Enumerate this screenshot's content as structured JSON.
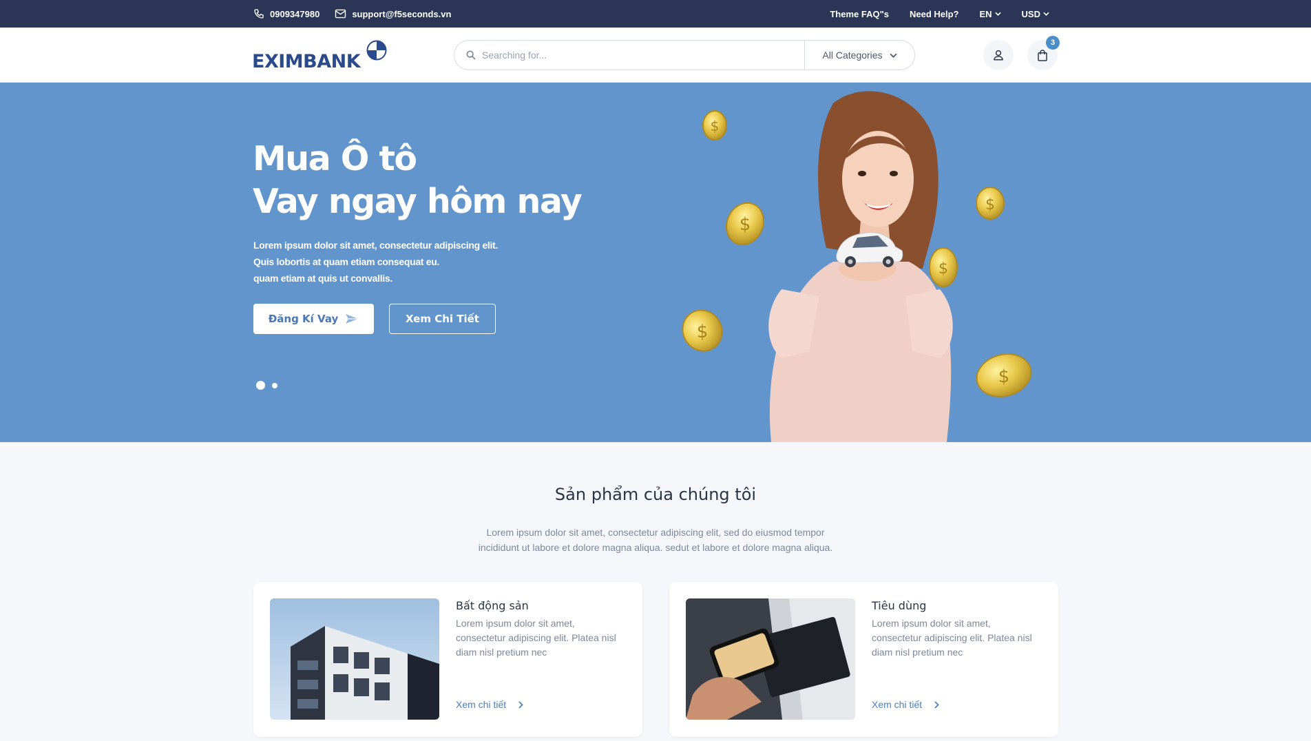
{
  "topbar": {
    "phone": "0909347980",
    "email": "support@f5seconds.vn",
    "faq": "Theme FAQ\"s",
    "help": "Need Help?",
    "language": "EN",
    "currency": "USD"
  },
  "header": {
    "logo_text": "EXIMBANK",
    "search_placeholder": "Searching for...",
    "category": "All Categories",
    "cart_count": "3"
  },
  "hero": {
    "title_line1": "Mua Ô tô",
    "title_line2": "Vay ngay hôm nay",
    "sub_line1": "Lorem ipsum dolor sit amet, consectetur adipiscing elit.",
    "sub_line2": "Quis lobortis at quam etiam consequat eu.",
    "sub_line3": "quam etiam at quis ut convallis.",
    "primary_button": "Đăng Kí Vay",
    "secondary_button": "Xem Chi Tiết",
    "slides": 2,
    "active_slide": 1
  },
  "products": {
    "title": "Sản phẩm của chúng tôi",
    "desc_line1": "Lorem ipsum dolor sit amet, consectetur adipiscing elit, sed do eiusmod tempor",
    "desc_line2": "incididunt ut labore et dolore magna aliqua. sedut et labore et dolore magna aliqua.",
    "items": [
      {
        "title": "Bất động sản",
        "text": "Lorem ipsum dolor sit amet, consectetur adipiscing elit. Platea nisl diam nisl pretium nec",
        "link": "Xem chi tiết"
      },
      {
        "title": "Tiêu dùng",
        "text": "Lorem ipsum dolor sit amet, consectetur adipiscing elit. Platea nisl diam nisl pretium nec",
        "link": "Xem chi tiết"
      }
    ]
  },
  "colors": {
    "topbar_bg": "#2b3657",
    "hero_bg": "#6195cb",
    "accent": "#4a7fbf",
    "badge": "#4a8ec9"
  },
  "icons": [
    "phone-icon",
    "mail-icon",
    "chevron-down-icon",
    "search-icon",
    "user-icon",
    "shopping-bag-icon",
    "send-icon",
    "chevron-right-icon"
  ]
}
